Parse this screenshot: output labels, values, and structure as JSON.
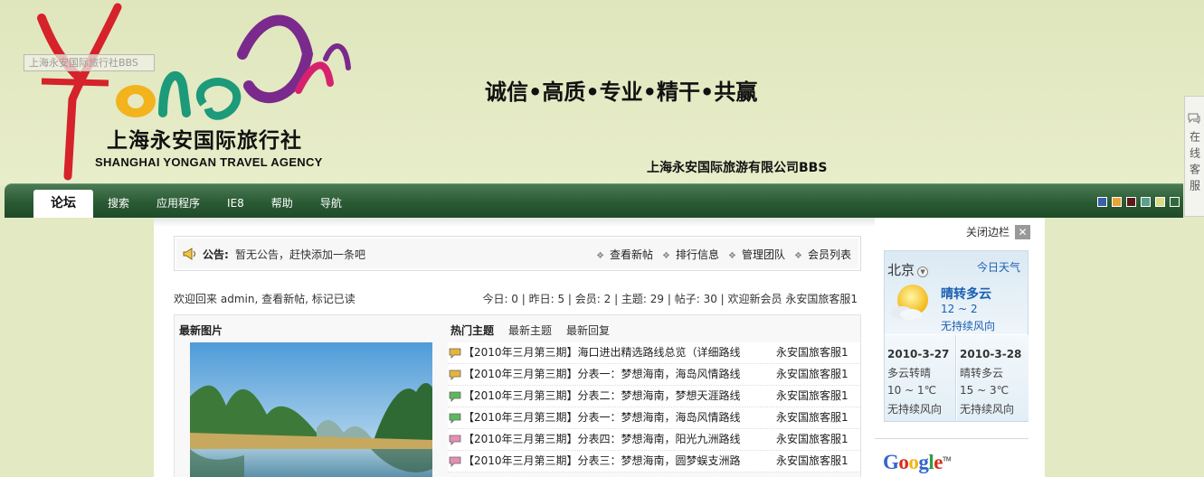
{
  "header": {
    "logo_text": "YONGAN",
    "logo_cn": "上海永安国际旅行社",
    "logo_en": "SHANGHAI YONGAN TRAVEL AGENCY",
    "tooltip": "上海永安国际旅行社BBS",
    "slogan": "诚信•高质•专业•精干•共赢",
    "bbs_title": "上海永安国际旅游有限公司BBS",
    "online_service": "在线客服",
    "online_service_icon": "chat-bubble-icon"
  },
  "nav": {
    "items": [
      "论坛",
      "搜索",
      "应用程序",
      "IE8",
      "帮助",
      "导航"
    ],
    "active_index": 0,
    "theme_swatches": [
      "#3b5fa8",
      "#e8a33a",
      "#5a1a1a",
      "#5c9e8e",
      "#d9d98a",
      "#2f6a3a"
    ]
  },
  "announcement": {
    "icon": "megaphone-icon",
    "label": "公告:",
    "text": "暂无公告，赶快添加一条吧",
    "links": [
      "查看新帖",
      "排行信息",
      "管理团队",
      "会员列表"
    ]
  },
  "welcome": {
    "prefix": "欢迎回来",
    "user": "admin",
    "view_new": "查看新帖",
    "mark_read": "标记已读",
    "stats": "今日: 0 | 昨日: 5 | 会员: 2 | 主题: 29 | 帖子: 30 | 欢迎新会员",
    "newest_member": "永安国旅客服1"
  },
  "pictures": {
    "title": "最新图片"
  },
  "topic_tabs": [
    "热门主题",
    "最新主题",
    "最新回复"
  ],
  "topic_tabs_active": 0,
  "topics": [
    {
      "title": "【2010年三月第三期】海口进出精选路线总览（详细路线",
      "author": "永安国旅客服1",
      "icon_color": "#e5b43a"
    },
    {
      "title": "【2010年三月第三期】分表一：梦想海南，海岛风情路线",
      "author": "永安国旅客服1",
      "icon_color": "#e5b43a"
    },
    {
      "title": "【2010年三月第三期】分表二：梦想海南，梦想天涯路线",
      "author": "永安国旅客服1",
      "icon_color": "#5cb85c"
    },
    {
      "title": "【2010年三月第三期】分表一：梦想海南，海岛风情路线",
      "author": "永安国旅客服1",
      "icon_color": "#5cb85c"
    },
    {
      "title": "【2010年三月第三期】分表四：梦想海南，阳光九洲路线",
      "author": "永安国旅客服1",
      "icon_color": "#e58fb4"
    },
    {
      "title": "【2010年三月第三期】分表三：梦想海南，圆梦蜈支洲路",
      "author": "永安国旅客服1",
      "icon_color": "#e58fb4"
    }
  ],
  "sidebar": {
    "close_label": "关闭边栏",
    "close_icon": "close-icon",
    "weather": {
      "city": "北京",
      "today_label": "今日天气",
      "icon": "sun-cloud-icon",
      "condition": "晴转多云",
      "temp": "12 ~ 2",
      "wind": "无持续风向",
      "forecast": [
        {
          "date": "2010-3-27",
          "condition": "多云转晴",
          "temp": "10 ~ 1℃",
          "wind": "无持续风向"
        },
        {
          "date": "2010-3-28",
          "condition": "晴转多云",
          "temp": "15 ~ 3℃",
          "wind": "无持续风向"
        }
      ]
    },
    "google_logo": "Google",
    "google_tm": "TM"
  }
}
